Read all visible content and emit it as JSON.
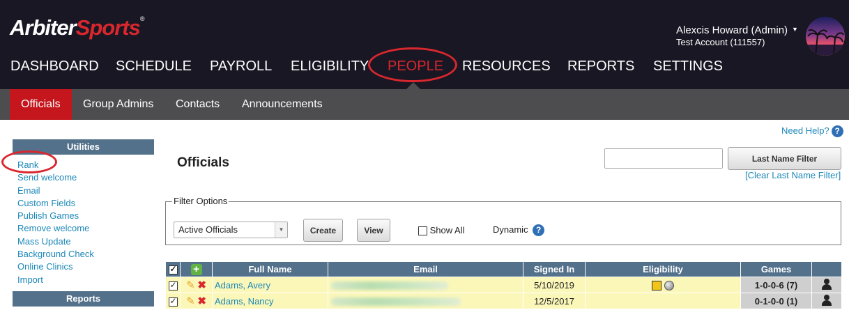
{
  "header": {
    "logo_main": "Arbiter",
    "logo_accent": "Sports",
    "logo_tm": "®",
    "user_name": "Alexcis Howard (Admin)",
    "account": "Test Account (111557)"
  },
  "nav": {
    "items": [
      "DASHBOARD",
      "SCHEDULE",
      "PAYROLL",
      "ELIGIBILITY",
      "PEOPLE",
      "RESOURCES",
      "REPORTS",
      "SETTINGS"
    ],
    "active": "PEOPLE"
  },
  "subnav": {
    "items": [
      "Officials",
      "Group Admins",
      "Contacts",
      "Announcements"
    ],
    "active": "Officials"
  },
  "sidebar": {
    "utilities_title": "Utilities",
    "links": [
      "Rank",
      "Send welcome",
      "Email",
      "Custom Fields",
      "Publish Games",
      "Remove welcome",
      "Mass Update",
      "Background Check",
      "Online Clinics",
      "Import"
    ],
    "reports_title": "Reports"
  },
  "main": {
    "need_help": "Need Help?",
    "help_glyph": "?",
    "title": "Officials",
    "name_filter_value": "",
    "last_name_filter_label": "Last Name Filter",
    "clear_filter_label": "[Clear Last Name Filter]",
    "filter_options_legend": "Filter Options",
    "filter_select_value": "Active Officials",
    "create_label": "Create",
    "view_label": "View",
    "show_all_label": "Show All",
    "dynamic_label": "Dynamic"
  },
  "table": {
    "headers": {
      "add": "+",
      "full_name": "Full Name",
      "email": "Email",
      "signed_in": "Signed In",
      "eligibility": "Eligibility",
      "games": "Games"
    },
    "rows": [
      {
        "name": "Adams, Avery",
        "signed_in": "5/10/2019",
        "games": "1-0-0-6 (7)",
        "games_status": "orange"
      },
      {
        "name": "Adams, Nancy",
        "signed_in": "12/5/2017",
        "games": "0-1-0-0 (1)",
        "games_status": "red"
      }
    ]
  },
  "colors": {
    "header_bg": "#181723",
    "accent_red": "#d9272e",
    "subnav_bg": "#4d4d4f",
    "table_header": "#54718b",
    "row_bg": "#fbf7b9",
    "link": "#1c87b8"
  }
}
